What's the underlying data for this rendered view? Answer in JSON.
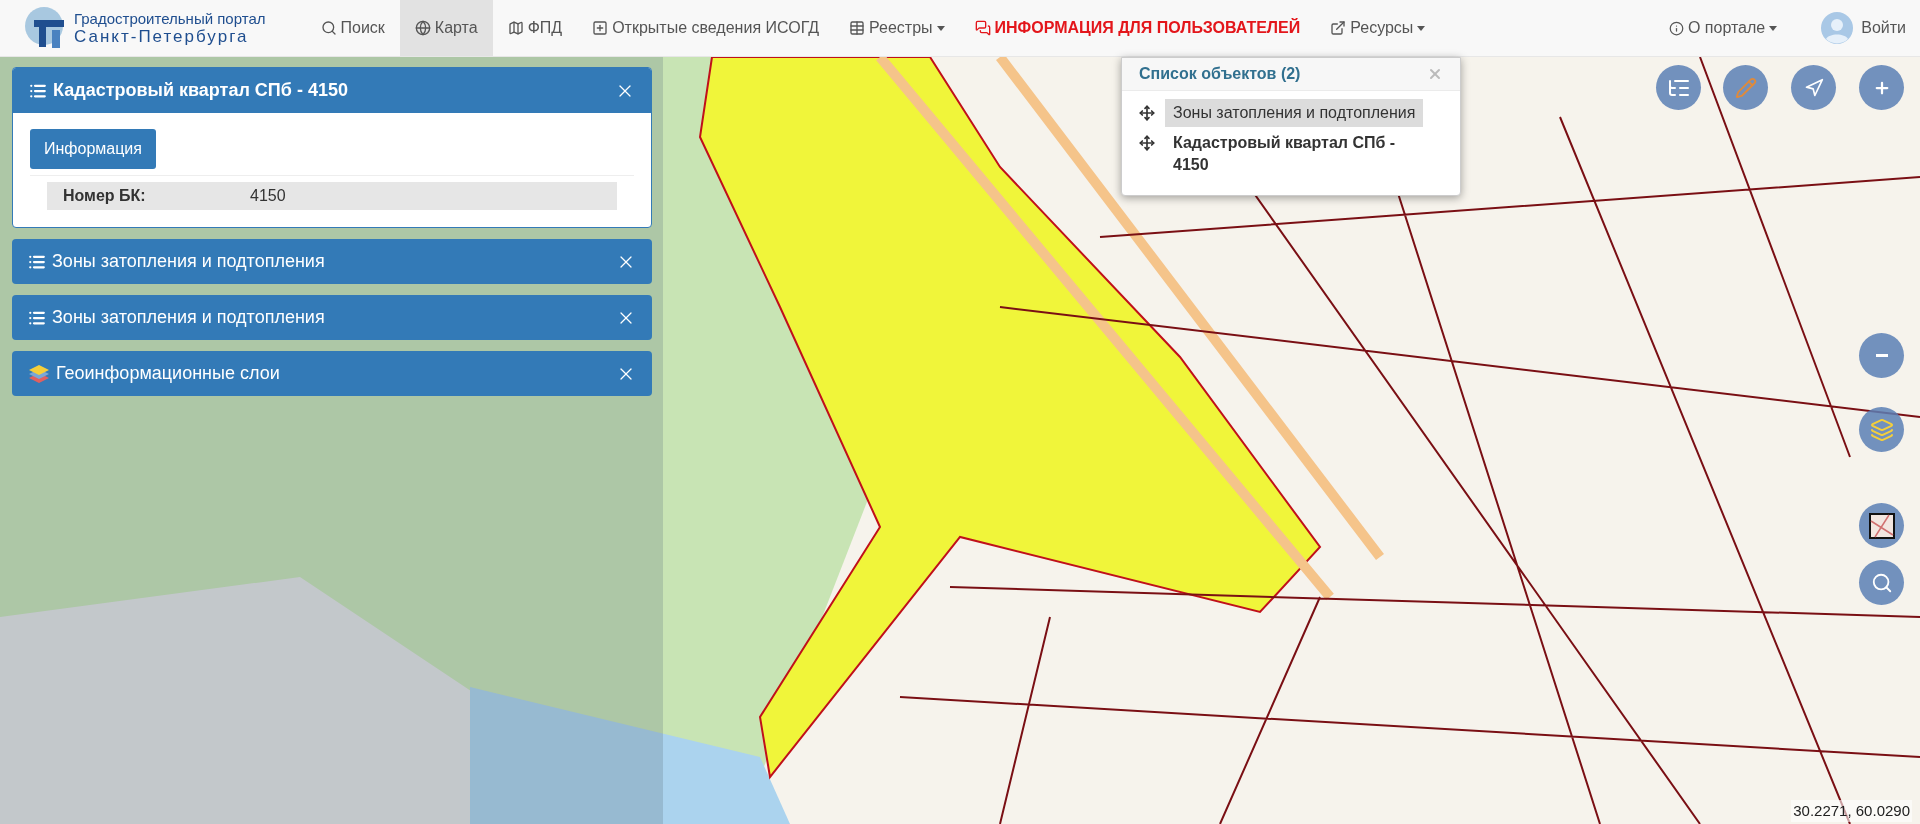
{
  "header": {
    "logo": {
      "line1": "Градостроительный портал",
      "line2": "Санкт-Петербурга"
    },
    "nav": [
      {
        "kind": "search",
        "label": "Поиск",
        "selected": false,
        "dropdown": false,
        "highlight": false
      },
      {
        "kind": "globe",
        "label": "Карта",
        "selected": true,
        "dropdown": false,
        "highlight": false
      },
      {
        "kind": "map",
        "label": "ФПД",
        "selected": false,
        "dropdown": false,
        "highlight": false
      },
      {
        "kind": "plus",
        "label": "Открытые сведения ИСОГД",
        "selected": false,
        "dropdown": false,
        "highlight": false
      },
      {
        "kind": "table",
        "label": "Реестры",
        "selected": false,
        "dropdown": true,
        "highlight": false
      },
      {
        "kind": "chat",
        "label": "ИНФОРМАЦИЯ ДЛЯ ПОЛЬЗОВАТЕЛЕЙ",
        "selected": false,
        "dropdown": false,
        "highlight": true
      },
      {
        "kind": "external",
        "label": "Ресурсы",
        "selected": false,
        "dropdown": true,
        "highlight": false
      }
    ],
    "right": [
      {
        "kind": "info",
        "label": "О портале",
        "dropdown": true
      },
      {
        "kind": "user",
        "label": "Войти",
        "dropdown": false
      }
    ]
  },
  "panels": [
    {
      "kind": "list",
      "title": "Кадастровый квартал СПб - 4150",
      "expanded": true,
      "button": "Информация",
      "fields": [
        {
          "label": "Номер БК:",
          "value": "4150"
        }
      ]
    },
    {
      "kind": "list",
      "title": "Зоны затопления и подтопления",
      "expanded": false
    },
    {
      "kind": "list",
      "title": "Зоны затопления и подтопления",
      "expanded": false
    },
    {
      "kind": "layers",
      "title": "Геоинформационные слои",
      "expanded": false
    }
  ],
  "popup": {
    "title": "Список объектов (2)",
    "items": [
      {
        "text": "Зоны затопления и подтопления",
        "selected": true,
        "bold": false
      },
      {
        "text": "Кадастровый квартал СПб - 4150",
        "selected": false,
        "bold": true
      }
    ]
  },
  "coordinates": "30.2271, 60.0290"
}
